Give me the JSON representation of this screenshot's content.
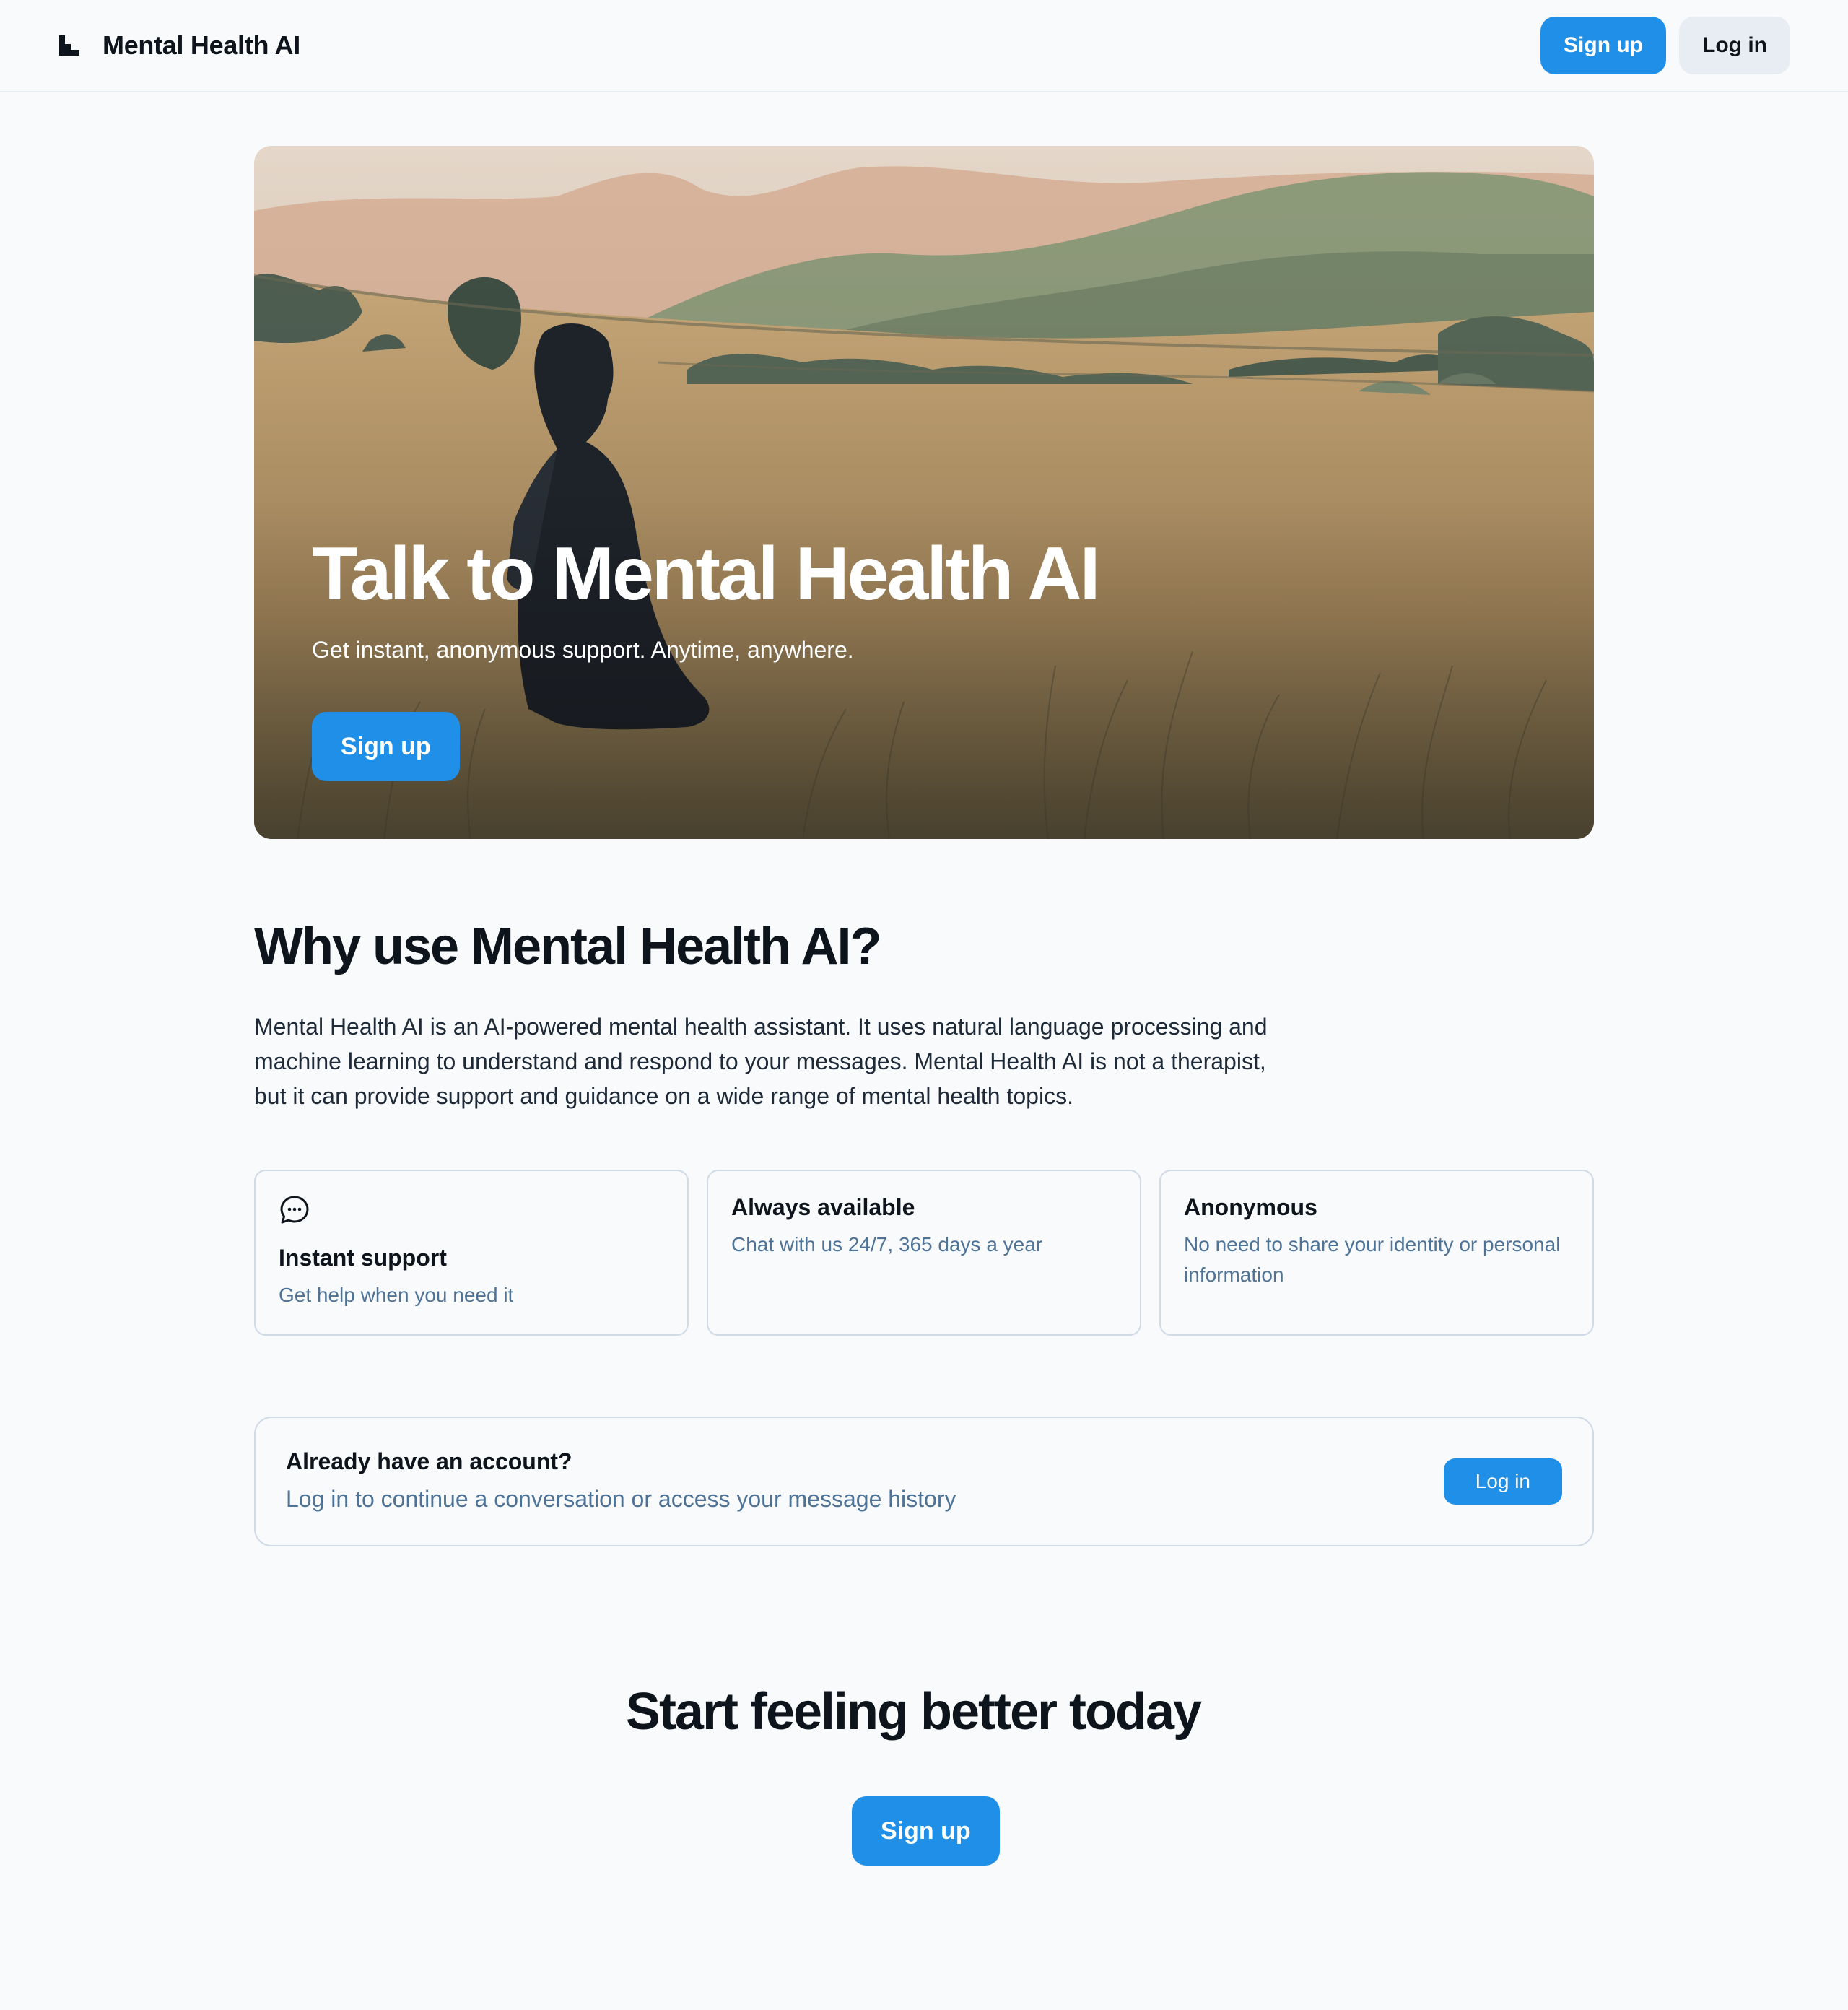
{
  "header": {
    "brand_name": "Mental Health AI",
    "logo_icon": "stair-logo-icon",
    "signup_label": "Sign up",
    "login_label": "Log in"
  },
  "hero": {
    "title": "Talk to Mental Health AI",
    "subtitle": "Get instant, anonymous support. Anytime, anywhere.",
    "signup_label": "Sign up"
  },
  "why": {
    "title": "Why use Mental Health AI?",
    "description": "Mental Health AI is an AI-powered mental health assistant. It uses natural language processing and machine learning to understand and respond to your messages. Mental Health AI is not a therapist, but it can provide support and guidance on a wide range of mental health topics."
  },
  "features": [
    {
      "icon": "chat-bubble-icon",
      "title": "Instant support",
      "text": "Get help when you need it"
    },
    {
      "title": "Always available",
      "text": "Chat with us 24/7, 365 days a year"
    },
    {
      "title": "Anonymous",
      "text": "No need to share your identity or personal information"
    }
  ],
  "account": {
    "title": "Already have an account?",
    "text": "Log in to continue a conversation or access your message history",
    "login_label": "Log in"
  },
  "cta": {
    "title": "Start feeling better today",
    "signup_label": "Sign up"
  },
  "colors": {
    "accent": "#1f8fe8",
    "background": "#f8fafc",
    "muted_text": "#4e7397",
    "border": "#d0dbe7"
  }
}
